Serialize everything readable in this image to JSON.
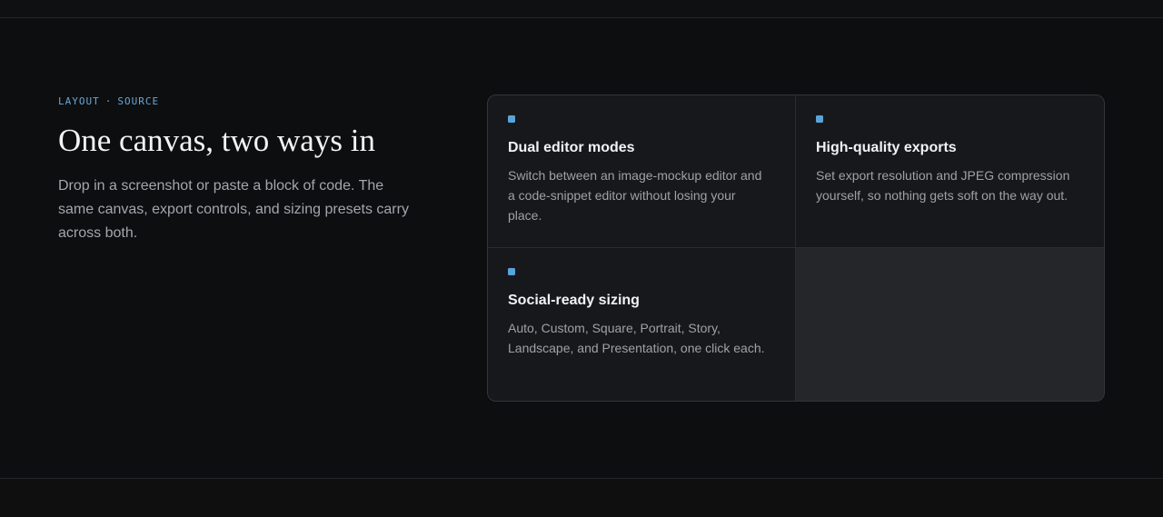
{
  "intro": {
    "eyebrow_left": "LAYOUT",
    "eyebrow_sep": "·",
    "eyebrow_right": "SOURCE",
    "title": "One canvas, two ways in",
    "description": "Drop in a screenshot or paste a block of code. The same canvas, export controls, and sizing presets carry across both."
  },
  "features": [
    {
      "title": "Dual editor modes",
      "description": "Switch between an image-mockup editor and a code-snippet editor without losing your place."
    },
    {
      "title": "High-quality exports",
      "description": "Set export resolution and JPEG compression yourself, so nothing gets soft on the way out."
    },
    {
      "title": "Social-ready sizing",
      "description": "Auto, Custom, Square, Portrait, Story, Landscape, and Presentation, one click each."
    }
  ],
  "colors": {
    "background": "#0d0e10",
    "accent": "#5aa3d8",
    "card": "#17181b"
  }
}
